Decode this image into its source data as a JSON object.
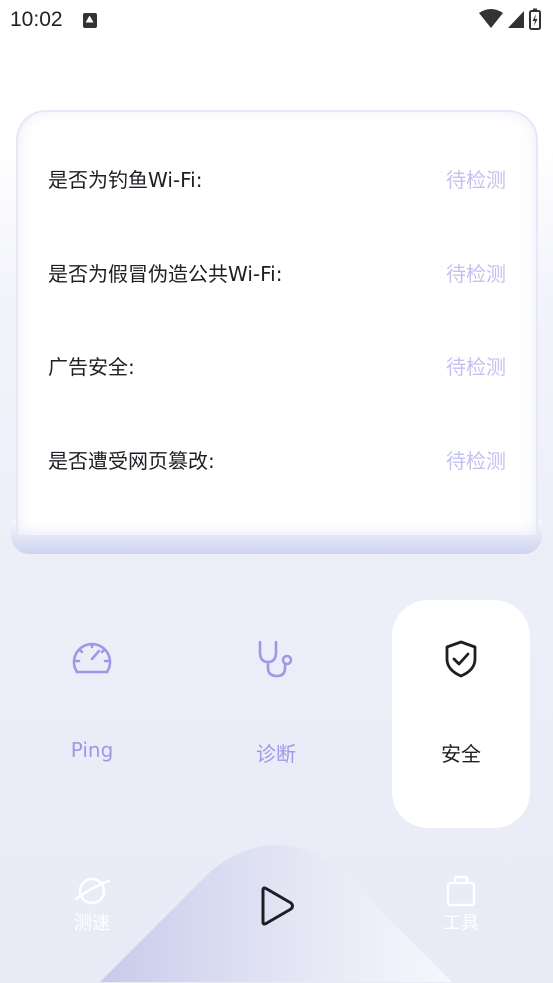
{
  "status_bar": {
    "time": "10:02"
  },
  "checks": [
    {
      "label": "是否为钓鱼Wi-Fi:",
      "status": "待检测"
    },
    {
      "label": "是否为假冒伪造公共Wi-Fi:",
      "status": "待检测"
    },
    {
      "label": "广告安全:",
      "status": "待检测"
    },
    {
      "label": "是否遭受网页篡改:",
      "status": "待检测"
    }
  ],
  "tabs": [
    {
      "label": "Ping",
      "icon": "speedometer-icon"
    },
    {
      "label": "诊断",
      "icon": "stethoscope-icon"
    },
    {
      "label": "安全",
      "icon": "shield-check-icon",
      "active": true
    }
  ],
  "bottom_nav": {
    "left_label": "测速",
    "right_label": "工具"
  },
  "colors": {
    "accent": "#9d99e6",
    "pending": "#c3c1f0",
    "text": "#1e1e24"
  }
}
